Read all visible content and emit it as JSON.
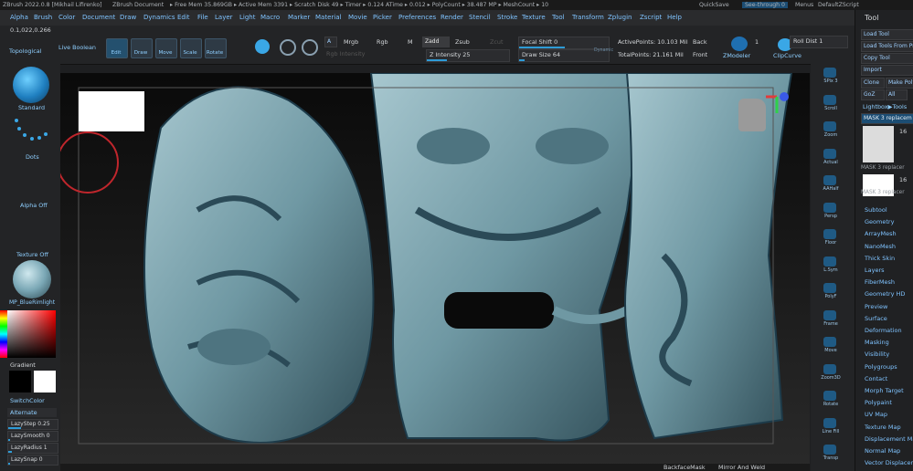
{
  "title_bar": {
    "app": "ZBrush 2022.0.8 [Mikhail Lifirenko]",
    "document": "ZBrush Document",
    "stats": "▸ Free Mem 35.869GB ▸ Active Mem 3391 ▸ Scratch Disk 49 ▸ Timer ▸ 0.124 ATime ▸ 0.012 ▸ PolyCount ▸ 38.487 MP ▸ MeshCount ▸ 10",
    "quicksave": "QuickSave",
    "seethrough": "See-through 0",
    "menus": "Menus",
    "script": "DefaultZScript"
  },
  "menu": [
    "Alpha",
    "Brush",
    "Color",
    "Document",
    "Draw",
    "Dynamics",
    "Edit",
    "File",
    "Layer",
    "Light",
    "Macro",
    "Marker",
    "Material",
    "Movie",
    "Picker",
    "Preferences",
    "Render",
    "Stencil",
    "Stroke",
    "Texture",
    "Tool",
    "Transform",
    "Zplugin",
    "Zscript",
    "Help"
  ],
  "toolbar": {
    "coords": "0.1,022,0.266",
    "topological": "Topological",
    "live_boolean": "Live Boolean",
    "edit": "Edit",
    "draw": "Draw",
    "move": "Move",
    "scale": "Scale",
    "rotate": "Rotate",
    "a": "A",
    "mrgb": "Mrgb",
    "rgb": "Rgb",
    "m": "M",
    "zadd": "Zadd",
    "zsub": "Zsub",
    "zcut": "Zcut",
    "rgb_intensity": "Rgb Intensity",
    "z_intensity": "Z Intensity 25",
    "focal_shift": "Focal Shift 0",
    "draw_size": "Draw Size 64",
    "dynamic": "Dynamic",
    "active_points": "ActivePoints: 10.103 Mil",
    "total_points": "TotalPoints: 21.161 Mil",
    "back": "Back",
    "front": "Front",
    "zmodeler": "ZModeler",
    "roll_dist": "Roll Dist 1",
    "clipcurve": "ClipCurve",
    "count_1": "1"
  },
  "left": {
    "standard": "Standard",
    "dots": "Dots",
    "alpha_off": "Alpha Off",
    "texture_off": "Texture Off",
    "material": "MP_BlueRimlight",
    "gradient": "Gradient",
    "switch_color": "SwitchColor",
    "alternate": "Alternate",
    "lazy_step": "LazyStep 0.25",
    "lazy_smooth": "LazySmooth 0",
    "lazy_radius": "LazyRadius 1",
    "lazy_snap": "LazySnap 0"
  },
  "shelf": [
    "SPix 3",
    "Scroll",
    "Zoom",
    "Actual",
    "AAHalf",
    "Persp",
    "Floor",
    "L.Sym",
    "PolyF",
    "Frame",
    "Move",
    "Zoom3D",
    "Rotate",
    "Line Fill",
    "Transp"
  ],
  "tool": {
    "header": "Tool",
    "load_tool": "Load Tool",
    "load_from_project": "Load Tools From Project",
    "copy_tool": "Copy Tool",
    "import": "Import",
    "clone": "Clone",
    "make_polymesh": "Make PolyMesh3D",
    "goz": "GoZ",
    "all": "All",
    "lightbox_tools": "Lightbox▶Tools",
    "current": "MASK 3 replacem",
    "thumb_count_1": "16",
    "thumb_label_1": "MASK 3 replacer",
    "thumb_count_2": "16",
    "thumb_label_2": "MASK 3 replacer",
    "items": [
      "Subtool",
      "Geometry",
      "ArrayMesh",
      "NanoMesh",
      "Thick Skin",
      "Layers",
      "FiberMesh",
      "Geometry HD",
      "Preview",
      "Surface",
      "Deformation",
      "Masking",
      "Visibility",
      "Polygroups",
      "Contact",
      "Morph Target",
      "Polypaint",
      "UV Map",
      "Texture Map",
      "Displacement Map",
      "Normal Map",
      "Vector Displacement"
    ]
  },
  "bottom": {
    "backface": "BackfaceMask",
    "mirror": "Mirror And Weld"
  },
  "colors": {
    "accent": "#2e9bd6",
    "label_blue": "#7fc3ff",
    "mesh": "#7ea9b3",
    "panel": "#232426"
  }
}
